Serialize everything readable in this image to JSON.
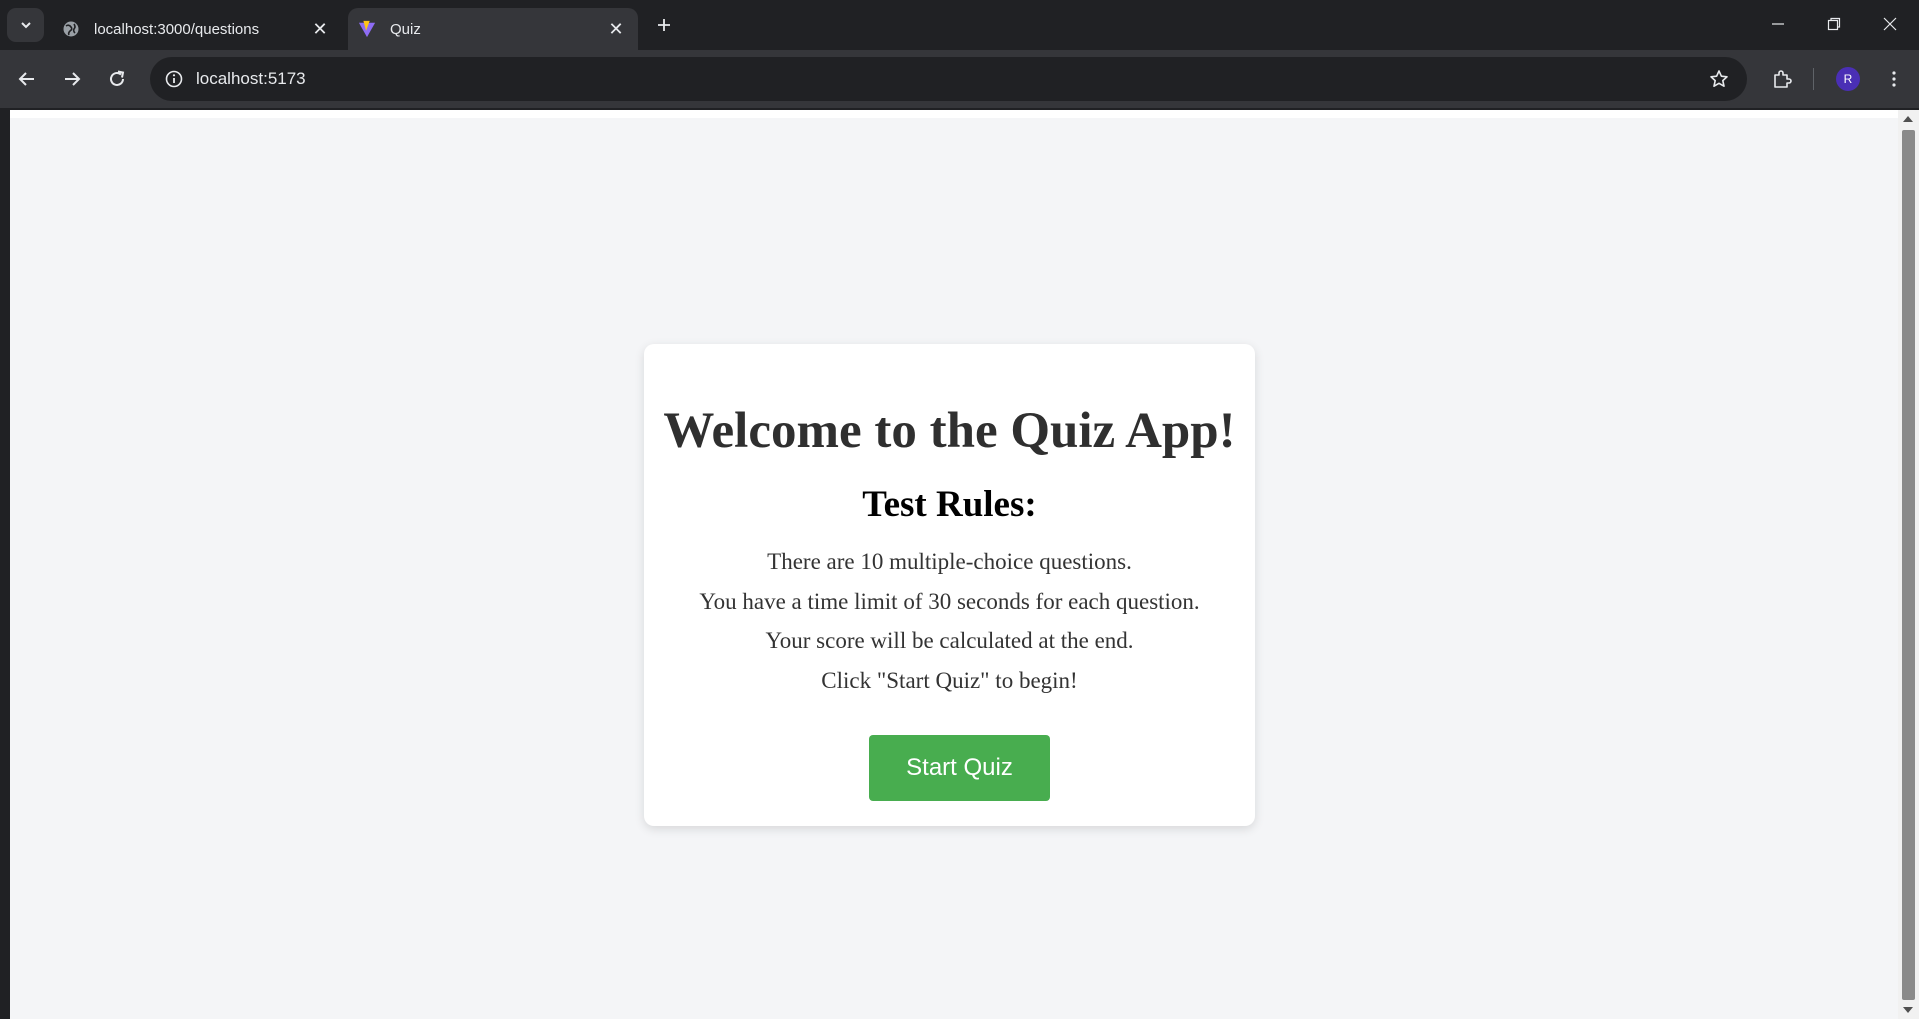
{
  "browser": {
    "tabs": [
      {
        "title": "localhost:3000/questions",
        "favicon": "globe-icon",
        "active": false
      },
      {
        "title": "Quiz",
        "favicon": "vite-logo-icon",
        "active": true
      }
    ],
    "address_bar": {
      "url": "localhost:5173"
    },
    "profile_initial": "R"
  },
  "quiz": {
    "title": "Welcome to the Quiz App!",
    "rules_heading": "Test Rules:",
    "rules": [
      "There are 10 multiple-choice questions.",
      "You have a time limit of 30 seconds for each question.",
      "Your score will be calculated at the end.",
      "Click \"Start Quiz\" to begin!"
    ],
    "start_button_label": "Start Quiz"
  },
  "colors": {
    "chrome_dark": "#202124",
    "chrome_toolbar": "#35363a",
    "page_background": "#f4f5f7",
    "card_background": "#ffffff",
    "button_green": "#48ad4f",
    "avatar_purple": "#4a2fb5"
  }
}
